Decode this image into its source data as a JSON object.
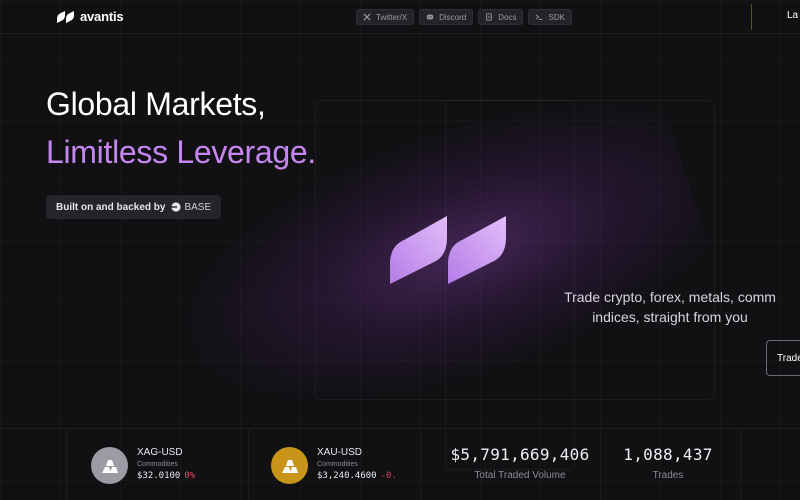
{
  "header": {
    "brand": "avantis",
    "links": [
      {
        "label": "Twitter/X",
        "icon": "x-icon"
      },
      {
        "label": "Discord",
        "icon": "discord-icon"
      },
      {
        "label": "Docs",
        "icon": "docs-icon"
      },
      {
        "label": "SDK",
        "icon": "terminal-icon"
      }
    ],
    "launch_label": "La"
  },
  "hero": {
    "title_line1": "Global Markets,",
    "title_line2": "Limitless Leverage.",
    "built_label": "Built on and backed by",
    "base_label": "BASE",
    "tagline_line1": "Trade crypto, forex, metals, comm",
    "tagline_line2": "indices, straight from you",
    "trade_button": "Trade"
  },
  "stats": {
    "assets": [
      {
        "symbol": "XAG-USD",
        "category": "Commodities",
        "price": "$32.0100",
        "change": "0%",
        "icon": "silver-bars-icon"
      },
      {
        "symbol": "XAU-USD",
        "category": "Commodities",
        "price": "$3,240.4600",
        "change": "-0.",
        "icon": "gold-bars-icon"
      }
    ],
    "volume_value": "$5,791,669,406",
    "volume_label": "Total Traded Volume",
    "trades_value": "1,088,437",
    "trades_label": "Trades"
  },
  "colors": {
    "background": "#111114",
    "accent_purple": "#c686f0",
    "negative": "#d9455e",
    "gold": "#c8951a",
    "silver": "#9b9ba3"
  }
}
